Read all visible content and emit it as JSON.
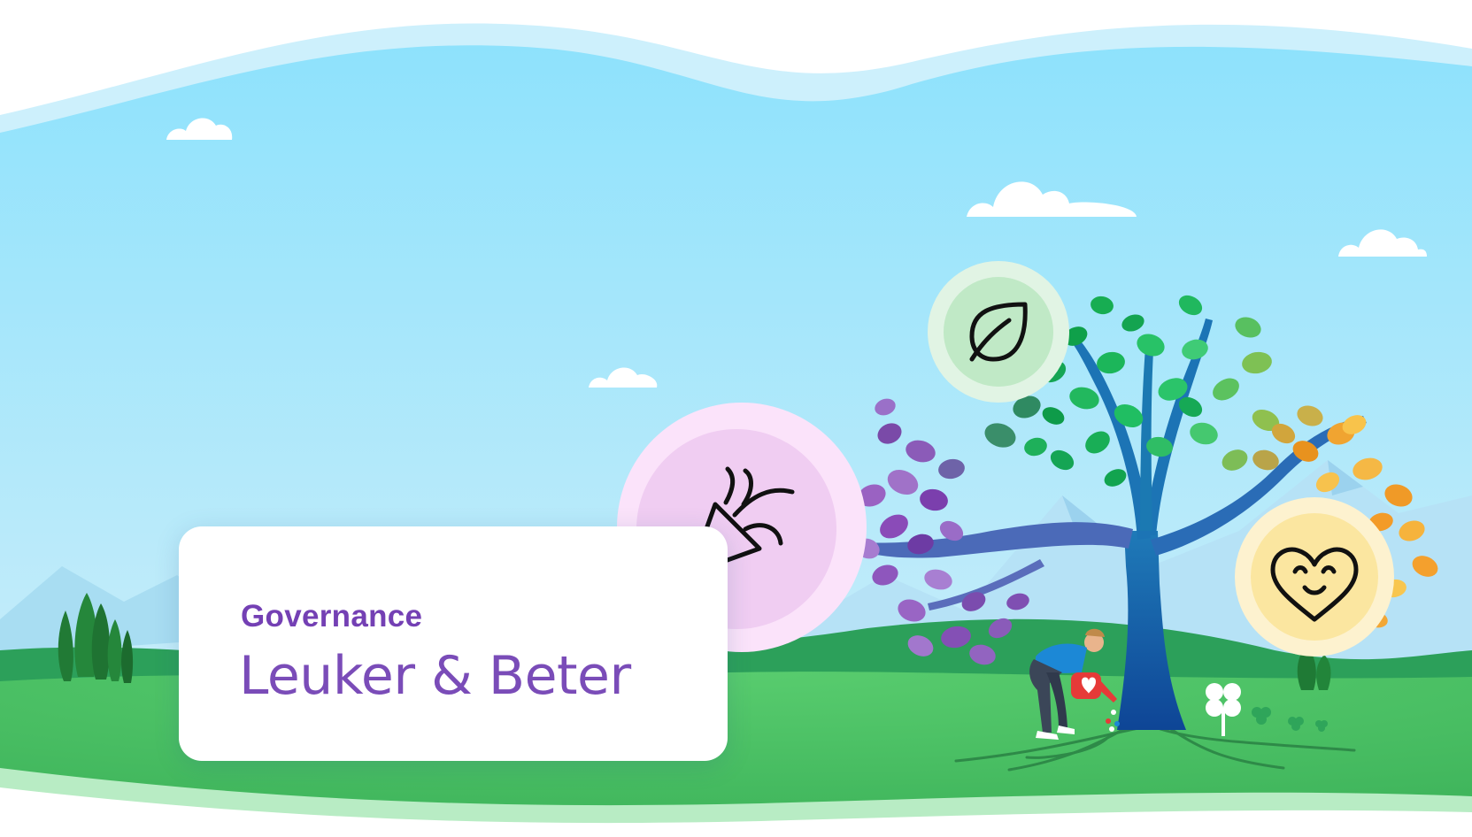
{
  "hero": {
    "kicker": "Governance",
    "title": "Leuker & Beter"
  },
  "badges": [
    {
      "icon": "party-popper-icon"
    },
    {
      "icon": "leaf-icon"
    },
    {
      "icon": "smiling-heart-icon"
    }
  ],
  "colors": {
    "sky_top": "#8ee2fc",
    "sky_bottom": "#cdeefb",
    "grass": "#4fc768",
    "hill_dark": "#29a35a",
    "accent_purple": "#7440b4",
    "party_badge": "#f0cdf2",
    "leaf_badge": "#c0e9c6",
    "heart_badge": "#fbe6a0",
    "tree_trunk": "#1551a8"
  }
}
